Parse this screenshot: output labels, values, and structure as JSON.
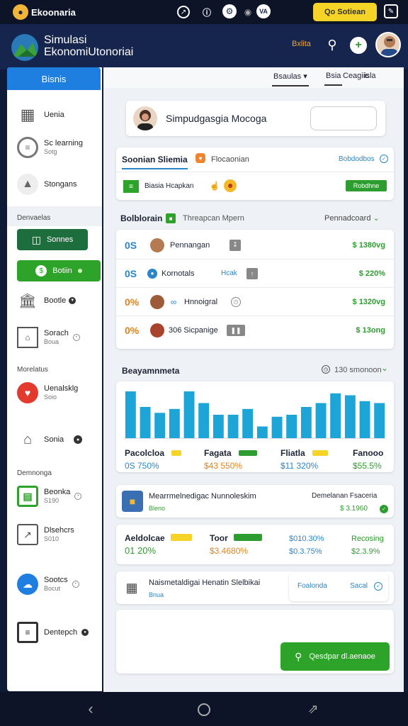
{
  "status": {
    "app_name": "Ekoonaria",
    "action_button": "Qo Sotiean"
  },
  "header": {
    "title_line1": "Simulasi",
    "title_line2": "EkonomiUtonoriai",
    "badge": "Bxlita"
  },
  "sidebar": {
    "tab_label": "Bisnis",
    "items": [
      {
        "label": "Uenia",
        "sub": ""
      },
      {
        "label": "Sc learning",
        "sub": "Sotg"
      },
      {
        "label": "Stongans",
        "sub": ""
      }
    ],
    "section1": "Denvaelas",
    "item_green1": "Sonnes",
    "item_green2": "Botiin",
    "items2": [
      {
        "label": "Bootle",
        "sub": ""
      },
      {
        "label": "Sorach",
        "sub": "Boua"
      }
    ],
    "section2": "Morelatus",
    "items3": [
      {
        "label": "Uenalsklg",
        "sub": "Soio"
      },
      {
        "label": "Sonia",
        "sub": ""
      }
    ],
    "section3": "Demnonga",
    "items4": [
      {
        "label": "Beonka",
        "sub": "S190"
      },
      {
        "label": "Dlsehcrs",
        "sub": "S010"
      },
      {
        "label": "Sootcs",
        "sub": "Bocut"
      },
      {
        "label": "Dentepch",
        "sub": ""
      }
    ]
  },
  "topnav": {
    "tab1": "Bsaulas",
    "tab2": "Bsia",
    "tab3": "Ceagiic",
    "tab4": "isla"
  },
  "profile_card": {
    "name": "Simpudgasgia Mocoga"
  },
  "summary": {
    "title": "Soonian Sliemia",
    "tag": "Flocaonian",
    "link": "Bobdodbos",
    "row_label": "Biasia Hcapkan",
    "row_button": "Robdhne"
  },
  "list": {
    "title": "Bolblorain",
    "subtitle": "Threapcan Mpern",
    "dropdown": "Pennadcoard",
    "rows": [
      {
        "pct": "0S",
        "name": "Pennangan",
        "value": "$ 1380vg"
      },
      {
        "pct": "0S",
        "name": "Kornotals",
        "tag": "Hcak",
        "value": "$ 220%"
      },
      {
        "pct": "0%",
        "name": "Hnnoigral",
        "value": "$ 1320vg"
      },
      {
        "pct": "0%",
        "name": "306 Sicpanige",
        "value": "$ 13ong"
      }
    ]
  },
  "chart_section": {
    "title": "Beayamnmeta",
    "meta": "130 smonoon",
    "stats": [
      {
        "label": "Pacolcloa",
        "value": "0S 750%"
      },
      {
        "label": "Fagata",
        "value": "$43 550%"
      },
      {
        "label": "Fliatla",
        "value": "$11 320%"
      },
      {
        "label": "Fanooo",
        "value": "$55.5%"
      }
    ]
  },
  "chart_data": {
    "type": "bar",
    "bars": [
      48,
      32,
      26,
      30,
      48,
      36,
      24,
      24,
      30,
      12,
      22,
      24,
      32,
      36,
      46,
      44,
      38,
      36
    ]
  },
  "promo1": {
    "title": "Mearrmelnedigac Nunnoleskim",
    "sub": "Bleno",
    "right_title": "Demelanan Fsaceria",
    "right_value": "$ 3.1960"
  },
  "stats2": [
    {
      "label": "Aeldolcae",
      "value": "01 20%"
    },
    {
      "label": "Toor",
      "value": "$3.4680%"
    },
    {
      "label": "$010.30%",
      "value": "$0.3.75%"
    },
    {
      "label": "Recosing",
      "value": "$2.3.9%"
    }
  ],
  "promo2": {
    "title": "Naismetaldigai Henatin Slelbikai",
    "sub": "Bnua",
    "pill_left": "Foalonda",
    "pill_right": "Sacal"
  },
  "cta": {
    "label": "Qesdpar dl.aenaoe"
  }
}
